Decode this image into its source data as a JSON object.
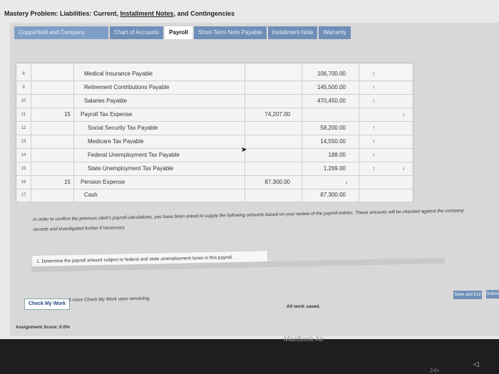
{
  "page": {
    "title_prefix": "Mastery Problem: Liabilities: Current, ",
    "title_link": "Installment Notes",
    "title_suffix": ", and Contingencies"
  },
  "tabs": [
    {
      "label": "Copperfield and Company"
    },
    {
      "label": "Chart of Accounts"
    },
    {
      "label": "Payroll"
    },
    {
      "label": "Short-Term Note Payable"
    },
    {
      "label": "Installment Note"
    },
    {
      "label": "Warranty"
    }
  ],
  "journal": {
    "rows": [
      {
        "num": "8",
        "day": "",
        "account": "Medical Insurance Payable",
        "debit": "",
        "credit": "106,700.00",
        "mark_credit": "↑",
        "mark_right": ""
      },
      {
        "num": "9",
        "day": "",
        "account": "Retirement Contributions Payable",
        "debit": "",
        "credit": "145,500.00",
        "mark_credit": "↑",
        "mark_right": ""
      },
      {
        "num": "10",
        "day": "",
        "account": "Salaries Payable",
        "debit": "",
        "credit": "470,450.00",
        "mark_credit": "↑",
        "mark_right": ""
      },
      {
        "num": "11",
        "day": "15",
        "account": "Payroll Tax Expense",
        "debit": "74,207.00",
        "credit": "",
        "mark_credit": "",
        "mark_right": "↓"
      },
      {
        "num": "12",
        "day": "",
        "account": "Social Security Tax Payable",
        "debit": "",
        "credit": "58,200.00",
        "mark_credit": "↑",
        "mark_right": ""
      },
      {
        "num": "13",
        "day": "",
        "account": "Medicare Tax Payable",
        "debit": "",
        "credit": "14,550.00",
        "mark_credit": "↑",
        "mark_right": ""
      },
      {
        "num": "14",
        "day": "",
        "account": "Federal Unemployment Tax Payable",
        "debit": "",
        "credit": "188.00",
        "mark_credit": "↑",
        "mark_right": ""
      },
      {
        "num": "15",
        "day": "",
        "account": "State Unemployment Tax Payable",
        "debit": "",
        "credit": "1,269.00",
        "mark_credit": "↑",
        "mark_right": ""
      },
      {
        "num": "16",
        "day": "15",
        "account": "Pension Expense",
        "debit": "87,300.00",
        "credit": "",
        "mark_credit": "",
        "mark_right": "↓"
      },
      {
        "num": "17",
        "day": "",
        "account": "Cash",
        "debit": "",
        "credit": "87,300.00",
        "mark_credit": "",
        "mark_right": ""
      }
    ],
    "extra_mark": "↓"
  },
  "instructions": {
    "text": "In order to confirm the previous clerk's payroll calculations, you have been asked to supply the following amounts based on your review of the payroll entries. These amounts will be checked against the company records and investigated further if necessary.",
    "question": "1. Determine the payroll amount subject to federal and state unemployment taxes in this payroll."
  },
  "footer": {
    "check_label": "Check My Work",
    "remaining": "3 more Check My Work uses remaining",
    "saved": "All work saved.",
    "save_exit": "Save and Exit",
    "submit": "Submit",
    "score": "Assignment Score: 0.0%"
  },
  "device": {
    "brand": "MacBook Air"
  }
}
